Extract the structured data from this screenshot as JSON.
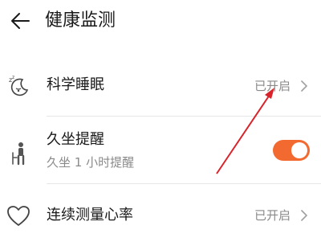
{
  "header": {
    "title": "健康监测",
    "back_icon": "back-arrow-icon"
  },
  "rows": [
    {
      "icon": "sleep-moon-icon",
      "label": "科学睡眠",
      "value": "已开启"
    },
    {
      "icon": "sitting-person-icon",
      "label": "久坐提醒",
      "sub": "久坐 1 小时提醒",
      "toggle_on": true
    },
    {
      "icon": "heart-icon",
      "label": "连续测量心率",
      "value": "已开启"
    }
  ],
  "colors": {
    "toggle_on": "#f26a30",
    "annotation_arrow": "#d8232a",
    "secondary_text": "#8a8a8a"
  }
}
